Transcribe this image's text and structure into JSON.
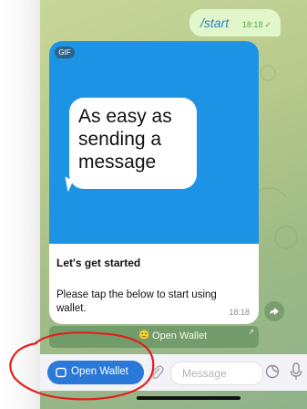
{
  "chat": {
    "outgoing": {
      "text": "/start",
      "time": "18:18"
    },
    "card": {
      "gif_badge": "GIF",
      "gif_text": "As easy as sending a message",
      "title": "Let's get started",
      "body": "Please tap the below to start using wallet.",
      "time": "18:18"
    },
    "inline_button": {
      "emoji": "🙂",
      "label": "Open Wallet"
    }
  },
  "input_bar": {
    "menu_button_label": "Open Wallet",
    "message_placeholder": "Message"
  },
  "colors": {
    "accent": "#2a79d8",
    "gif_background": "#1d93e6",
    "annotation": "#e02020"
  },
  "icons": [
    "share-icon",
    "wallet-icon",
    "paperclip-icon",
    "sticker-icon",
    "microphone-icon",
    "check-icon"
  ]
}
